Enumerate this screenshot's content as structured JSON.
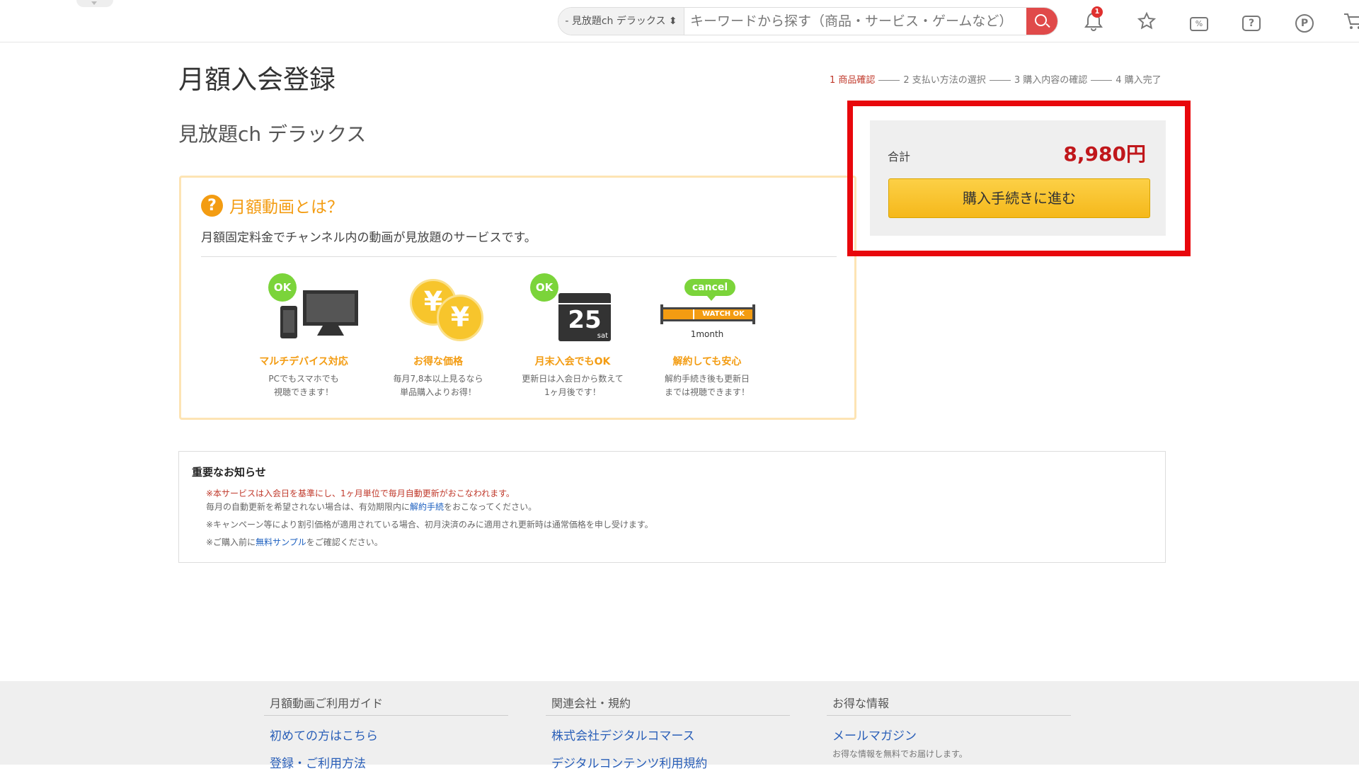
{
  "header": {
    "search_scope": "- 見放題ch デラックス ⬍",
    "search_placeholder": "キーワードから探す（商品・サービス・ゲームなど）",
    "notification_count": "1",
    "coupon_icon_text": "%",
    "help_icon_text": "?",
    "point_icon_text": "P"
  },
  "page": {
    "title": "月額入会登録",
    "product_name": "見放題ch デラックス",
    "steps": [
      "1 商品確認",
      "2 支払い方法の選択",
      "3 購入内容の確認",
      "4 購入完了"
    ]
  },
  "info": {
    "heading": "月額動画とは？",
    "description": "月額固定料金でチャンネル内の動画が見放題のサービスです。",
    "features": [
      {
        "badge": "OK",
        "title": "マルチデバイス対応",
        "text": "PCでもスマホでも\n視聴できます！"
      },
      {
        "badge": "¥",
        "title": "お得な価格",
        "text": "毎月7,8本以上見るなら\n単品購入よりお得！"
      },
      {
        "badge": "OK",
        "date": "25",
        "day": "sat",
        "title": "月末入会でもOK",
        "text": "更新日は入会日から数えて\n1ヶ月後です！"
      },
      {
        "badge": "cancel",
        "bar_text": "WATCH OK",
        "period": "1month",
        "title": "解約しても安心",
        "text": "解約手続き後も更新日\nまでは視聴できます！"
      }
    ]
  },
  "notice": {
    "title": "重要なお知らせ",
    "line1": "※本サービスは入会日を基準にし、1ヶ月単位で毎月自動更新がおこなわれます。",
    "line2_pre": "毎月の自動更新を希望されない場合は、有効期限内に",
    "line2_link": "解約手続",
    "line2_post": "をおこなってください。",
    "line3": "※キャンペーン等により割引価格が適用されている場合、初月決済のみに適用され更新時は通常価格を申し受けます。",
    "line4_pre": "※ご購入前に",
    "line4_link": "無料サンプル",
    "line4_post": "をご確認ください。"
  },
  "summary": {
    "total_label": "合計",
    "total_value": "8,980円",
    "buy_button": "購入手続きに進む"
  },
  "footer": {
    "col1": {
      "heading": "月額動画ご利用ガイド",
      "links": [
        "初めての方はこちら",
        "登録・ご利用方法"
      ]
    },
    "col2": {
      "heading": "関連会社・規約",
      "links": [
        "株式会社デジタルコマース",
        "デジタルコンテンツ利用規約"
      ]
    },
    "col3": {
      "heading": "お得な情報",
      "links": [
        "メールマガジン"
      ],
      "sub": "お得な情報を無料でお届けします。"
    }
  },
  "colors": {
    "accent": "#f39c12",
    "price": "#c0171b",
    "highlight": "#e8070c",
    "link": "#2a5fb8"
  },
  "icons": [
    "bell-icon",
    "star-icon",
    "coupon-icon",
    "help-icon",
    "point-icon",
    "cart-icon",
    "search-icon"
  ]
}
